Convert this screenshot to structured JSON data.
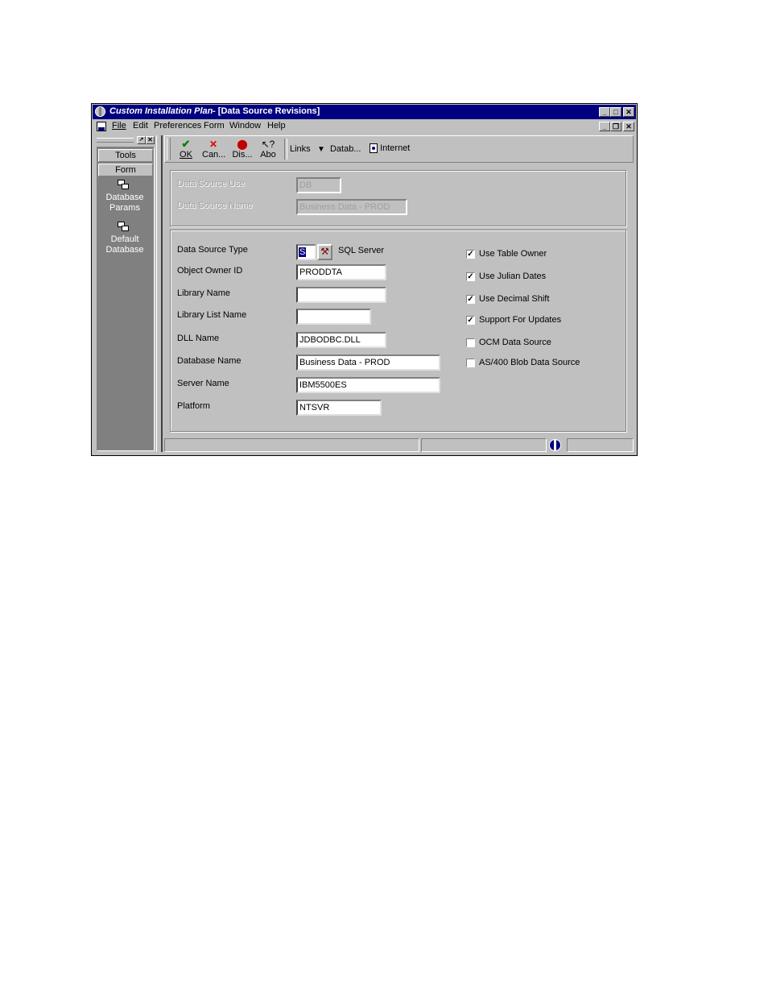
{
  "window": {
    "title_app": "Custom Installation Plan",
    "title_form": " - [Data Source Revisions]"
  },
  "menu": {
    "items": [
      {
        "label": "File"
      },
      {
        "label": "Edit"
      },
      {
        "label": "Preferences"
      },
      {
        "label": "Form"
      },
      {
        "label": "Window"
      },
      {
        "label": "Help"
      }
    ]
  },
  "sidebar": {
    "buttons": [
      {
        "label": "Tools"
      },
      {
        "label": "Form"
      }
    ],
    "items": [
      {
        "line1": "Database",
        "line2": "Params",
        "icon": "tables-icon"
      },
      {
        "line1": "Default",
        "line2": "Database",
        "icon": "tables-icon"
      }
    ]
  },
  "toolbar": {
    "ok": "OK",
    "cancel": "Can...",
    "display": "Dis...",
    "about": "Abo",
    "links": "Links",
    "datab": "Datab...",
    "internet": "Internet"
  },
  "header_fields": {
    "use_label": "Data Source Use",
    "use_value": "DB",
    "name_label": "Data Source Name",
    "name_value": "Business Data - PROD"
  },
  "form": {
    "type_label": "Data Source Type",
    "type_value": "S",
    "type_desc": "SQL Server",
    "owner_label": "Object Owner ID",
    "owner_value": "PRODDTA",
    "library_label": "Library Name",
    "library_value": "",
    "liblist_label": "Library List Name",
    "liblist_value": "",
    "dll_label": "DLL Name",
    "dll_value": "JDBODBC.DLL",
    "db_label": "Database Name",
    "db_value": "Business Data - PROD",
    "server_label": "Server Name",
    "server_value": "IBM5500ES",
    "platform_label": "Platform",
    "platform_value": "NTSVR"
  },
  "checkboxes": [
    {
      "label": "Use Table Owner",
      "checked": true
    },
    {
      "label": "Use Julian Dates",
      "checked": true
    },
    {
      "label": "Use Decimal Shift",
      "checked": true
    },
    {
      "label": "Support For Updates",
      "checked": true
    },
    {
      "label": "OCM Data Source",
      "checked": false
    },
    {
      "label": "AS/400 Blob Data Source",
      "checked": false
    }
  ],
  "colors": {
    "titlebar": "#000080",
    "sidebar": "#808080",
    "face": "#c0c0c0"
  }
}
